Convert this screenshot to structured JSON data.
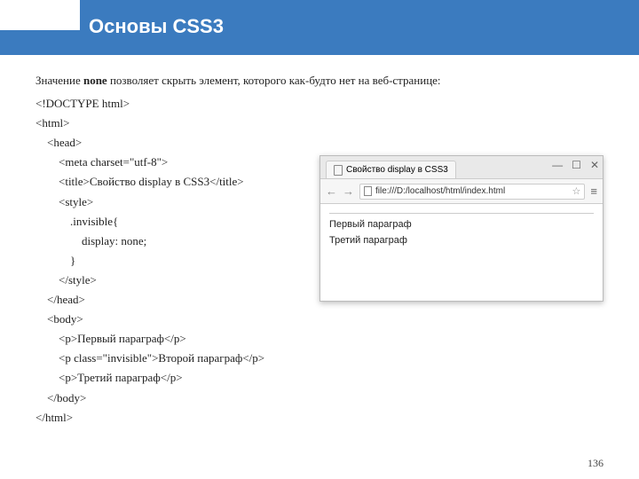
{
  "slide": {
    "title": "Основы CSS3",
    "page_number": "136"
  },
  "intro": {
    "pre": "Значение ",
    "bold": "none",
    "post": " позволяет скрыть элемент, которого как-будто нет на веб-странице:"
  },
  "code": {
    "l1": "<!DOCTYPE html>",
    "l2": "<html>",
    "l3": "    <head>",
    "l4": "        <meta charset=\"utf-8\">",
    "l5": "        <title>Свойство display в CSS3</title>",
    "l6": "        <style>",
    "l7": "            .invisible{",
    "l8": "                display: none;",
    "l9": "            }",
    "l10": "        </style>",
    "l11": "    </head>",
    "l12": "    <body>",
    "l13": "        <p>Первый параграф</p>",
    "l14": "        <p class=\"invisible\">Второй параграф</p>",
    "l15": "        <p>Третий параграф</p>",
    "l16": "    </body>",
    "l17": "</html>"
  },
  "browser": {
    "tab_title": "Свойство display в CSS3",
    "url": "file:///D:/localhost/html/index.html",
    "win": {
      "min": "—",
      "max": "☐",
      "close": "✕"
    },
    "nav": {
      "back": "←",
      "fwd": "→",
      "menu": "≡",
      "star": "☆"
    },
    "page": {
      "p1": "Первый параграф",
      "p2": "Третий параграф"
    }
  }
}
